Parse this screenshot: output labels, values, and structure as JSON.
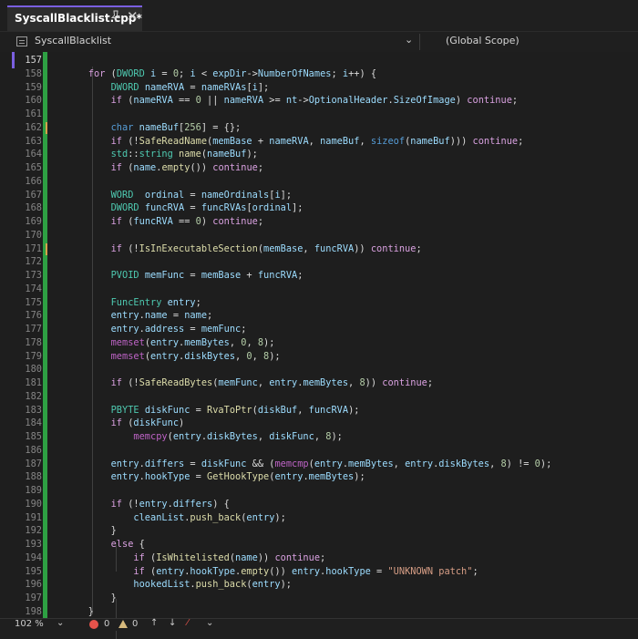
{
  "tab": {
    "title": "SyscallBlacklist.cpp*",
    "close": "✕"
  },
  "nav": {
    "file": "SyscallBlacklist",
    "scope": "(Global Scope)",
    "chevron": "⌄"
  },
  "status": {
    "zoom": "102 %",
    "errors": "0",
    "warnings": "0",
    "up": "↑",
    "down": "↓",
    "chevron": "⌄"
  },
  "editor": {
    "active_line": 157,
    "modified_markers": [
      162,
      171
    ],
    "lines": [
      {
        "n": "157",
        "t": ""
      },
      {
        "n": "158",
        "t": "    for (DWORD i = 0; i < expDir->NumberOfNames; i++) {"
      },
      {
        "n": "159",
        "t": "        DWORD nameRVA = nameRVAs[i];"
      },
      {
        "n": "160",
        "t": "        if (nameRVA == 0 || nameRVA >= nt->OptionalHeader.SizeOfImage) continue;"
      },
      {
        "n": "161",
        "t": ""
      },
      {
        "n": "162",
        "t": "        char nameBuf[256] = {};"
      },
      {
        "n": "163",
        "t": "        if (!SafeReadName(memBase + nameRVA, nameBuf, sizeof(nameBuf))) continue;"
      },
      {
        "n": "164",
        "t": "        std::string name(nameBuf);"
      },
      {
        "n": "165",
        "t": "        if (name.empty()) continue;"
      },
      {
        "n": "166",
        "t": ""
      },
      {
        "n": "167",
        "t": "        WORD  ordinal = nameOrdinals[i];"
      },
      {
        "n": "168",
        "t": "        DWORD funcRVA = funcRVAs[ordinal];"
      },
      {
        "n": "169",
        "t": "        if (funcRVA == 0) continue;"
      },
      {
        "n": "170",
        "t": ""
      },
      {
        "n": "171",
        "t": "        if (!IsInExecutableSection(memBase, funcRVA)) continue;"
      },
      {
        "n": "172",
        "t": ""
      },
      {
        "n": "173",
        "t": "        PVOID memFunc = memBase + funcRVA;"
      },
      {
        "n": "174",
        "t": ""
      },
      {
        "n": "175",
        "t": "        FuncEntry entry;"
      },
      {
        "n": "176",
        "t": "        entry.name = name;"
      },
      {
        "n": "177",
        "t": "        entry.address = memFunc;"
      },
      {
        "n": "178",
        "t": "        memset(entry.memBytes, 0, 8);"
      },
      {
        "n": "179",
        "t": "        memset(entry.diskBytes, 0, 8);"
      },
      {
        "n": "180",
        "t": ""
      },
      {
        "n": "181",
        "t": "        if (!SafeReadBytes(memFunc, entry.memBytes, 8)) continue;"
      },
      {
        "n": "182",
        "t": ""
      },
      {
        "n": "183",
        "t": "        PBYTE diskFunc = RvaToPtr(diskBuf, funcRVA);"
      },
      {
        "n": "184",
        "t": "        if (diskFunc)"
      },
      {
        "n": "185",
        "t": "            memcpy(entry.diskBytes, diskFunc, 8);"
      },
      {
        "n": "186",
        "t": ""
      },
      {
        "n": "187",
        "t": "        entry.differs = diskFunc && (memcmp(entry.memBytes, entry.diskBytes, 8) != 0);"
      },
      {
        "n": "188",
        "t": "        entry.hookType = GetHookType(entry.memBytes);"
      },
      {
        "n": "189",
        "t": ""
      },
      {
        "n": "190",
        "t": "        if (!entry.differs) {"
      },
      {
        "n": "191",
        "t": "            cleanList.push_back(entry);"
      },
      {
        "n": "192",
        "t": "        }"
      },
      {
        "n": "193",
        "t": "        else {"
      },
      {
        "n": "194",
        "t": "            if (IsWhitelisted(name)) continue;"
      },
      {
        "n": "195",
        "t": "            if (entry.hookType.empty()) entry.hookType = \"UNKNOWN patch\";"
      },
      {
        "n": "196",
        "t": "            hookedList.push_back(entry);"
      },
      {
        "n": "197",
        "t": "        }"
      },
      {
        "n": "198",
        "t": "    }"
      }
    ]
  }
}
